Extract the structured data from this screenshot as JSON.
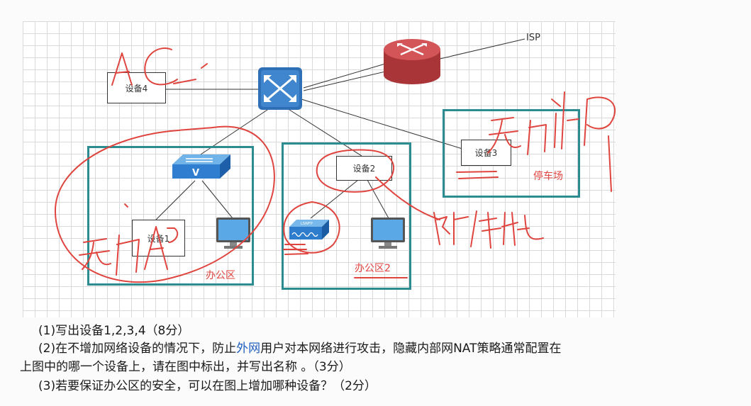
{
  "diagram": {
    "isp_label": "ISP",
    "device4": "设备4",
    "device1": "设备1",
    "device2": "设备2",
    "device3": "设备3",
    "zone_office": "办公区",
    "zone_office2": "办公区2",
    "zone_parking": "停车场",
    "firewall_badge": "LSWFP",
    "switch_mark": "V"
  },
  "questions": {
    "q1": "(1)写出设备1,2,3,4（8分）",
    "q2_before": "(2)在不增加网络设备的情况下，防止",
    "q2_link": "外网",
    "q2_after": "用户对本网络进行攻击，隐藏内部网NAT策略通常配置在",
    "q2_line2": "上图中的哪一个设备上，请在图中标出，并写出名称 。（3分）",
    "q3": "(3)若要保证办公区的安全，可以在图上增加哪种设备？（2分）"
  },
  "colors": {
    "zone_border": "#2c8c92",
    "ink": "#e0443e",
    "router_red": "#c9484b",
    "router_blue": "#2f6fb5"
  }
}
